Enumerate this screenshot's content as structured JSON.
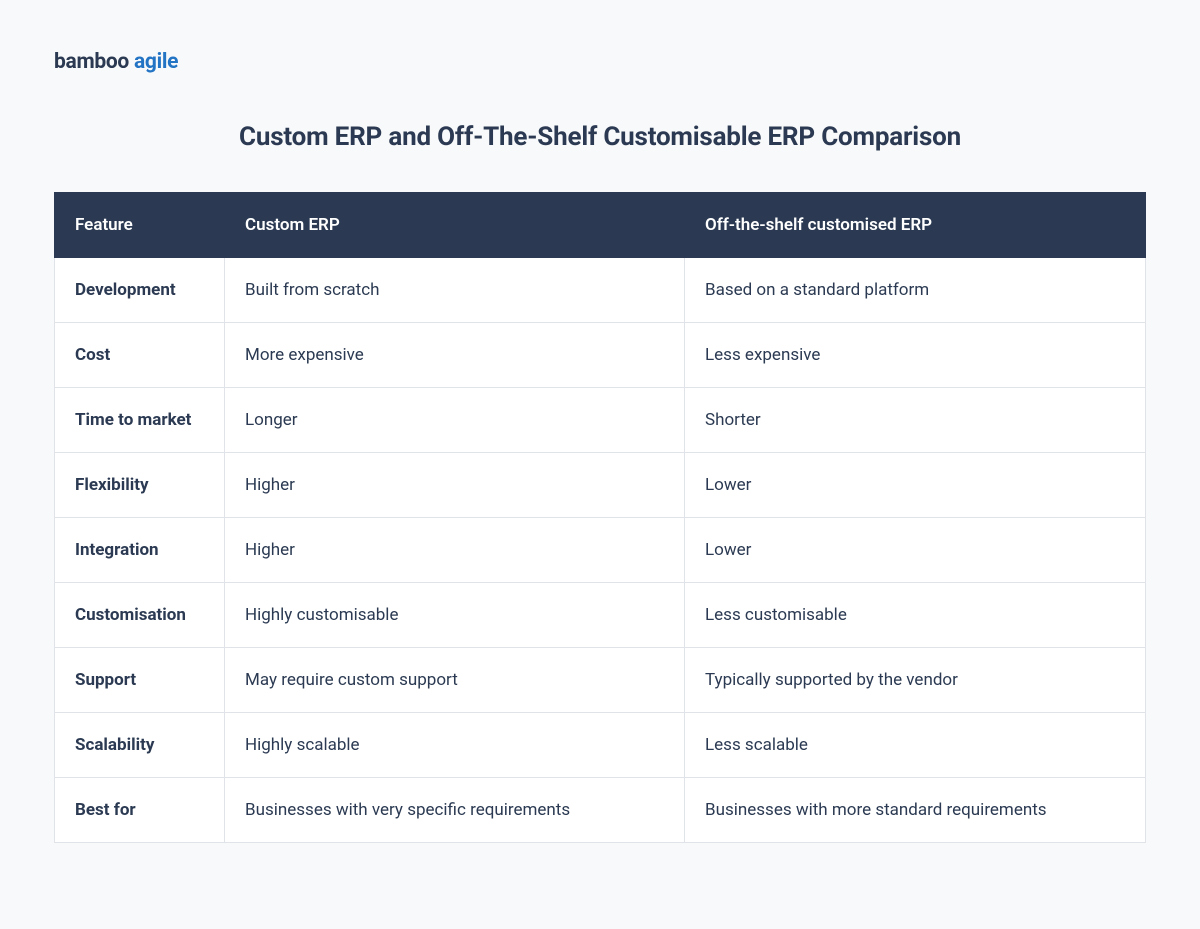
{
  "logo": {
    "primary": "bamboo",
    "secondary": "agile"
  },
  "title": "Custom ERP and Off-The-Shelf Customisable ERP Comparison",
  "table": {
    "headers": {
      "feature": "Feature",
      "custom": "Custom ERP",
      "ots": "Off-the-shelf customised ERP"
    },
    "rows": [
      {
        "feature": "Development",
        "custom": "Built from scratch",
        "ots": "Based on a standard platform"
      },
      {
        "feature": "Cost",
        "custom": "More expensive",
        "ots": "Less expensive"
      },
      {
        "feature": "Time to market",
        "custom": "Longer",
        "ots": "Shorter"
      },
      {
        "feature": "Flexibility",
        "custom": "Higher",
        "ots": "Lower"
      },
      {
        "feature": "Integration",
        "custom": "Higher",
        "ots": "Lower"
      },
      {
        "feature": "Customisation",
        "custom": "Highly customisable",
        "ots": "Less customisable"
      },
      {
        "feature": "Support",
        "custom": "May require custom support",
        "ots": "Typically supported by the vendor"
      },
      {
        "feature": "Scalability",
        "custom": "Highly scalable",
        "ots": "Less scalable"
      },
      {
        "feature": "Best for",
        "custom": "Businesses with very specific requirements",
        "ots": "Businesses with more standard requirements"
      }
    ]
  }
}
